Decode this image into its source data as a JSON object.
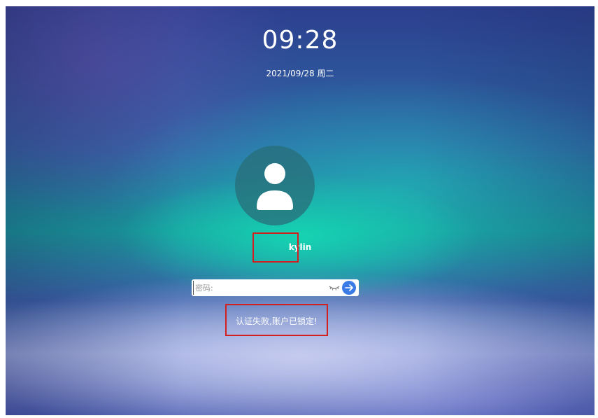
{
  "lock_screen": {
    "time": "09:28",
    "date": "2021/09/28 周二",
    "username": "kylin",
    "password_placeholder": "密码:",
    "error_message": "认证失败,账户已锁定!"
  },
  "icons": {
    "avatar": "user-silhouette-icon",
    "toggle_visibility": "eye-closed-icon",
    "submit": "arrow-right-icon"
  },
  "colors": {
    "submit_button": "#3b7be6",
    "highlight_box": "#d1201f"
  }
}
